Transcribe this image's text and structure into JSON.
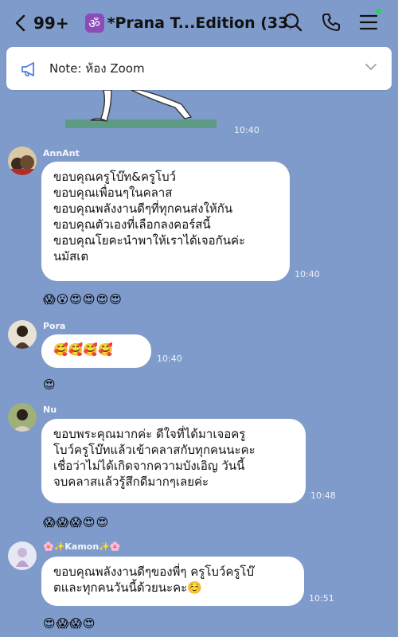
{
  "header": {
    "back_count": "99+",
    "group_title": "*Prana T...Edition (33)",
    "group_icon_glyph": "ॐ"
  },
  "note": {
    "text": "Note: ห้อง Zoom"
  },
  "image_message": {
    "time": "10:40"
  },
  "messages": [
    {
      "sender": "AnnAnt",
      "text": "ขอบคุณครูโบ๊ท&ครูโบว์\nขอบคุณเพื่อนๆในคลาส\nขอบคุณพลังงานดีๆที่ทุกคนส่งให้กัน\nขอบคุณตัวเองที่เลือกลงคอร์สนี้\nขอบคุณโยคะนำพาให้เราได้เจอกันค่ะ\nนมัสเต",
      "time": "10:40",
      "reactions": [
        "😱",
        "😮",
        "😍",
        "😍",
        "😍",
        "😍"
      ]
    },
    {
      "sender": "Pora",
      "text": "🥰🥰🥰🥰",
      "time": "10:40",
      "reactions": [
        "😍"
      ]
    },
    {
      "sender": "Nu",
      "text": "ขอบพระคุณมากค่ะ ดีใจที่ได้มาเจอครู\nโบว์ครูโบ๊ทแล้วเข้าคลาสกับทุกคนนะคะ\nเชื่อว่าไม่ได้เกิดจากความบังเอิญ วันนี้\nจบคลาสแล้วรู้สึกดีมากๆเลยค่ะ",
      "time": "10:48",
      "reactions": [
        "😱",
        "😱",
        "😱",
        "😍",
        "😍"
      ]
    },
    {
      "sender": "🌸✨Kamon✨🌸",
      "text": "ขอบคุณพลังงานดีๆของพี่ๆ ครูโบว์ครูโบ๊\nตและทุกคนวันนี้ด้วยนะคะ☺️",
      "time": "10:51",
      "reactions": [
        "😍",
        "😱",
        "😱",
        "😍"
      ]
    }
  ],
  "colors": {
    "chat_background": "#7f9bcb",
    "bubble": "#ffffff",
    "online_dot": "#27d35d",
    "group_icon_bg": "#8b4bb8"
  }
}
